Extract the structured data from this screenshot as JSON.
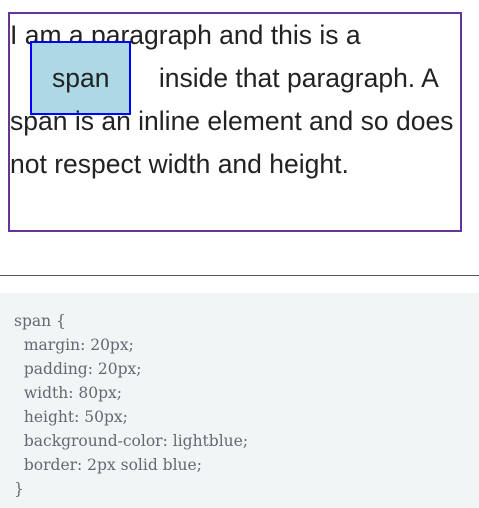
{
  "demo": {
    "text_before_span": "I am a paragraph and this is a ",
    "span_label": "span",
    "text_after_span": " inside that paragraph. A span is an inline element and so does not respect width and height."
  },
  "code": {
    "lines": [
      "span {",
      "  margin: 20px;",
      "  padding: 20px;",
      "  width: 80px;",
      "  height: 50px;",
      "  background-color: lightblue;",
      "  border: 2px solid blue;",
      "}"
    ]
  }
}
